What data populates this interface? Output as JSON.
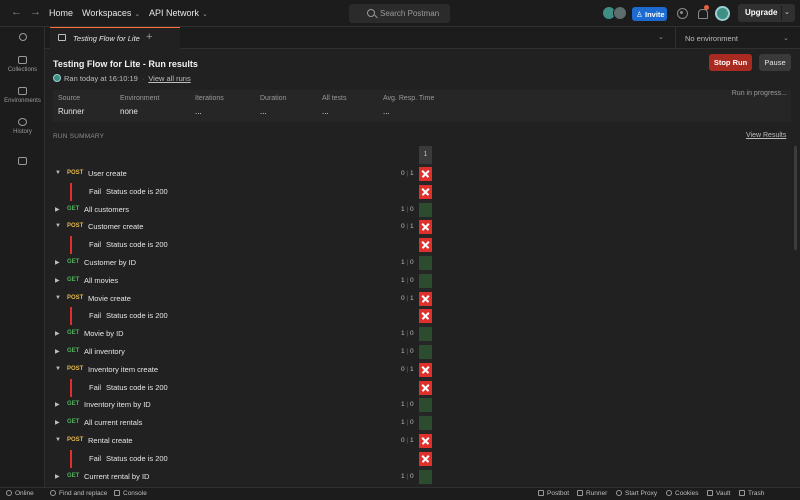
{
  "topbar": {
    "home": "Home",
    "workspaces": "Workspaces",
    "api_network": "API Network",
    "search_placeholder": "Search Postman",
    "invite": "Invite",
    "upgrade": "Upgrade"
  },
  "sidebar": {
    "items": [
      {
        "label": ""
      },
      {
        "label": "Collections"
      },
      {
        "label": "Environments"
      },
      {
        "label": "History"
      },
      {
        "label": ""
      }
    ]
  },
  "tabs": {
    "active_tab": "Testing Flow for Lite",
    "environment": "No environment"
  },
  "run": {
    "title": "Testing Flow for Lite - Run results",
    "ran_at": "Ran today at 16:10:19",
    "view_all_runs": "View all runs",
    "stop_label": "Stop Run",
    "pause_label": "Pause",
    "status": "Run in progress...",
    "info": {
      "source_label": "Source",
      "source_value": "Runner",
      "environment_label": "Environment",
      "environment_value": "none",
      "iterations_label": "Iterations",
      "iterations_value": "...",
      "duration_label": "Duration",
      "duration_value": "...",
      "all_tests_label": "All tests",
      "all_tests_value": "...",
      "avg_resp_label": "Avg. Resp. Time",
      "avg_resp_value": "..."
    }
  },
  "summary": {
    "header": "RUN SUMMARY",
    "view_results": "View Results",
    "iteration_col": "1",
    "rows": [
      {
        "type": "req",
        "method": "POST",
        "name": "User create",
        "passed": "0",
        "failed": "1",
        "result": "fail"
      },
      {
        "type": "test",
        "status": "Fail",
        "name": "Status code is 200",
        "result": "fail"
      },
      {
        "type": "req",
        "method": "GET",
        "name": "All customers",
        "passed": "1",
        "failed": "0",
        "result": "pass"
      },
      {
        "type": "req",
        "method": "POST",
        "name": "Customer create",
        "passed": "0",
        "failed": "1",
        "result": "fail"
      },
      {
        "type": "test",
        "status": "Fail",
        "name": "Status code is 200",
        "result": "fail"
      },
      {
        "type": "req",
        "method": "GET",
        "name": "Customer by ID",
        "passed": "1",
        "failed": "0",
        "result": "pass"
      },
      {
        "type": "req",
        "method": "GET",
        "name": "All movies",
        "passed": "1",
        "failed": "0",
        "result": "pass"
      },
      {
        "type": "req",
        "method": "POST",
        "name": "Movie create",
        "passed": "0",
        "failed": "1",
        "result": "fail"
      },
      {
        "type": "test",
        "status": "Fail",
        "name": "Status code is 200",
        "result": "fail"
      },
      {
        "type": "req",
        "method": "GET",
        "name": "Movie by ID",
        "passed": "1",
        "failed": "0",
        "result": "pass"
      },
      {
        "type": "req",
        "method": "GET",
        "name": "All inventory",
        "passed": "1",
        "failed": "0",
        "result": "pass"
      },
      {
        "type": "req",
        "method": "POST",
        "name": "Inventory item create",
        "passed": "0",
        "failed": "1",
        "result": "fail"
      },
      {
        "type": "test",
        "status": "Fail",
        "name": "Status code is 200",
        "result": "fail"
      },
      {
        "type": "req",
        "method": "GET",
        "name": "Inventory item by ID",
        "passed": "1",
        "failed": "0",
        "result": "pass"
      },
      {
        "type": "req",
        "method": "GET",
        "name": "All current rentals",
        "passed": "1",
        "failed": "0",
        "result": "pass"
      },
      {
        "type": "req",
        "method": "POST",
        "name": "Rental create",
        "passed": "0",
        "failed": "1",
        "result": "fail"
      },
      {
        "type": "test",
        "status": "Fail",
        "name": "Status code is 200",
        "result": "fail"
      },
      {
        "type": "req",
        "method": "GET",
        "name": "Current rental by ID",
        "passed": "1",
        "failed": "0",
        "result": "pass"
      }
    ]
  },
  "statusbar": {
    "online": "Online",
    "find_replace": "Find and replace",
    "console": "Console",
    "postbot": "Postbot",
    "runner": "Runner",
    "start_proxy": "Start Proxy",
    "cookies": "Cookies",
    "vault": "Vault",
    "trash": "Trash"
  },
  "colors": {
    "accent": "#ff6c37",
    "invite": "#1d6bd1",
    "stop": "#a92a20",
    "fail": "#e0302b",
    "pass": "#2d4b2e",
    "post": "#e5b64a",
    "get": "#4fb35b"
  },
  "icons": [
    "back-arrow-icon",
    "forward-arrow-icon",
    "search-icon",
    "settings-gear-icon",
    "notification-bell-icon",
    "collection-icon",
    "environment-icon",
    "history-icon",
    "fail-x-icon"
  ]
}
